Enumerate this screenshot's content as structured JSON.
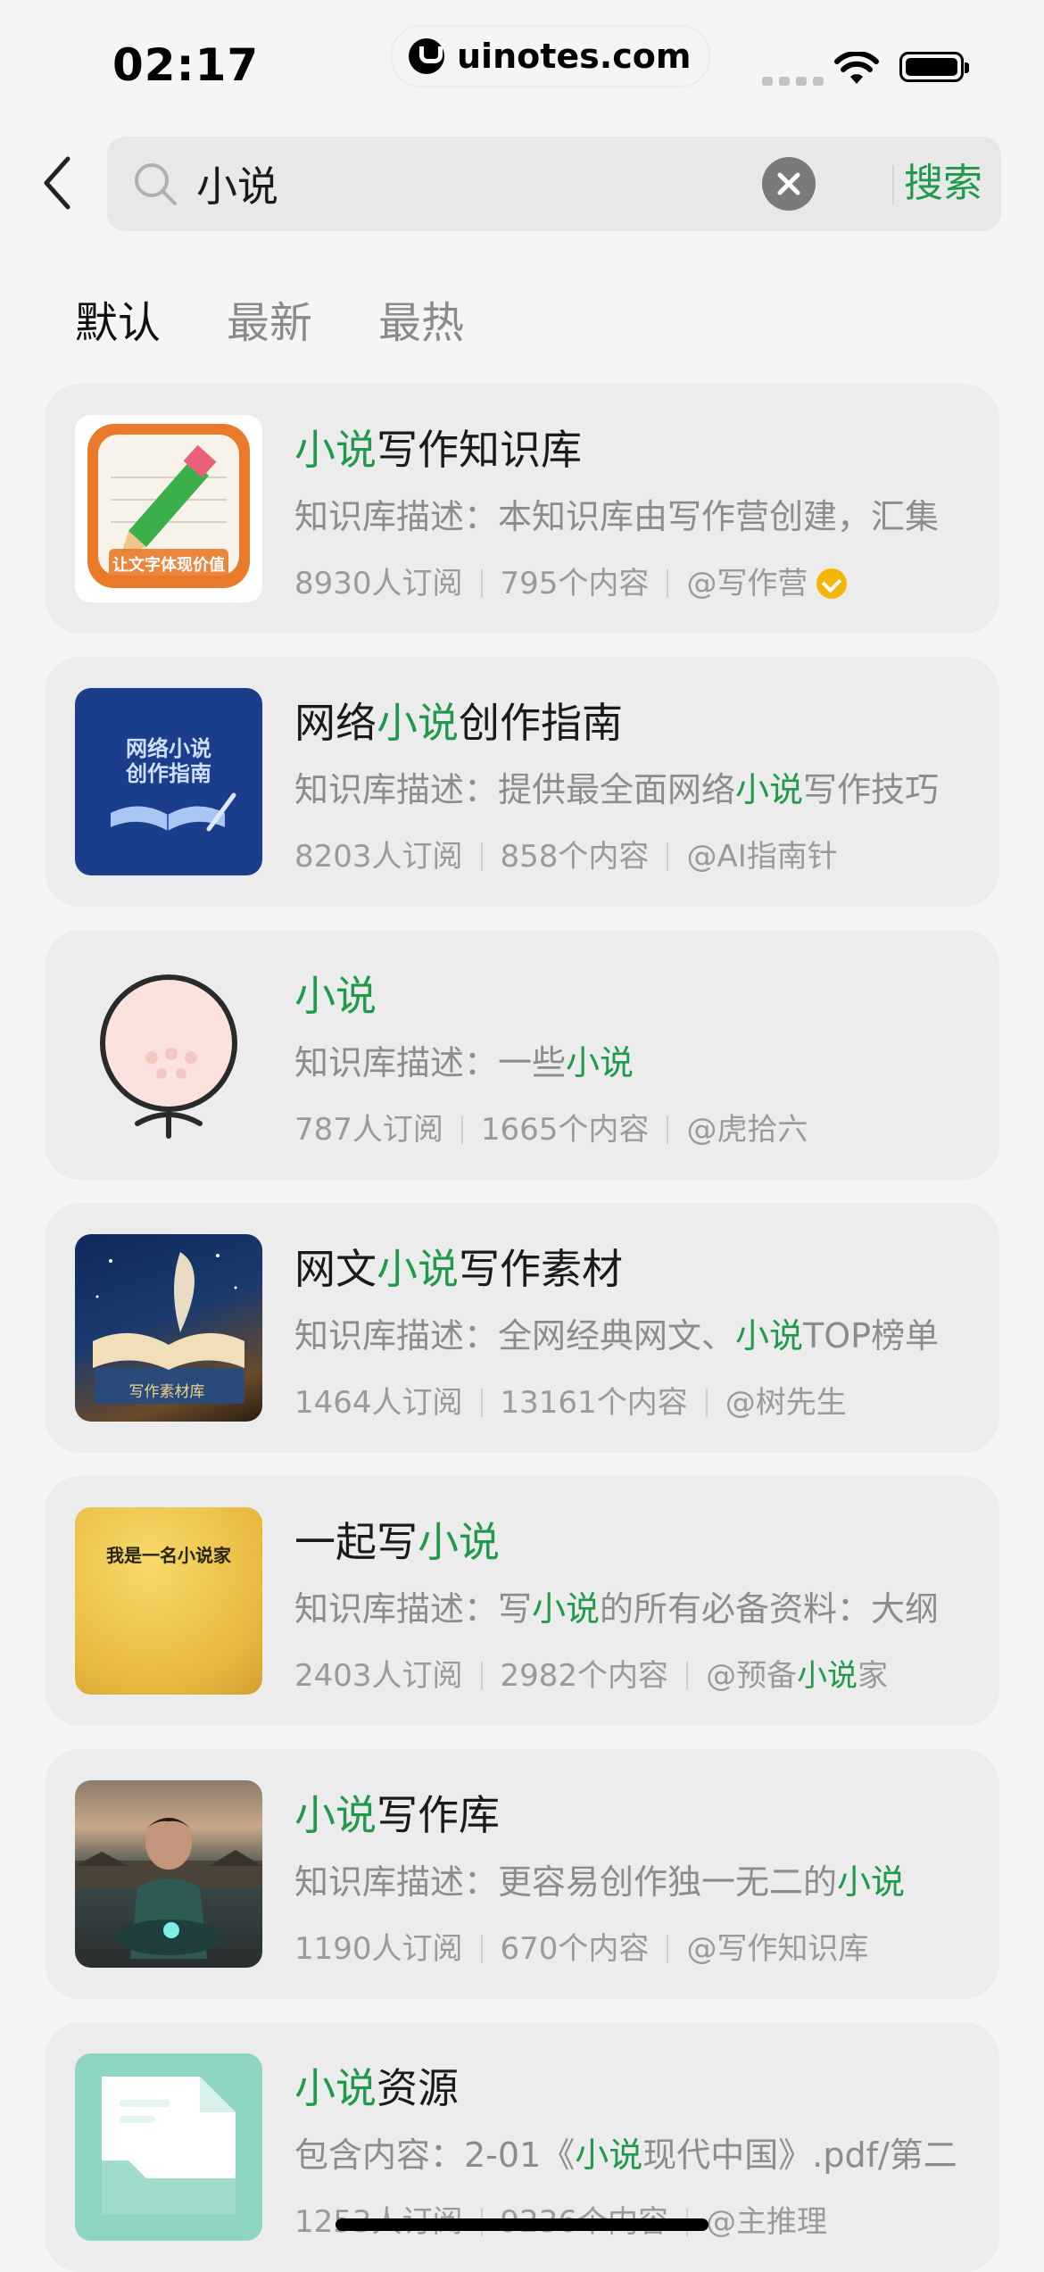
{
  "status": {
    "time": "02:17",
    "watermark": "uinotes.com"
  },
  "search": {
    "query": "小说",
    "placeholder": "小说",
    "submit_label": "搜索"
  },
  "tabs": [
    {
      "label": "默认"
    },
    {
      "label": "最新"
    },
    {
      "label": "最热"
    }
  ],
  "results": [
    {
      "title": [
        {
          "t": "小说",
          "hl": true
        },
        {
          "t": "写作知识库",
          "hl": false
        }
      ],
      "desc": [
        {
          "t": "知识库描述：本知识库由写作营创建，汇集",
          "hl": false
        }
      ],
      "subscribers": "8930人订阅",
      "contents": "795个内容",
      "author": "@写作营",
      "verified": true,
      "thumb_text": "让文字体现价值"
    },
    {
      "title": [
        {
          "t": "网络",
          "hl": false
        },
        {
          "t": "小说",
          "hl": true
        },
        {
          "t": "创作指南",
          "hl": false
        }
      ],
      "desc": [
        {
          "t": "知识库描述：提供最全面网络",
          "hl": false
        },
        {
          "t": "小说",
          "hl": true
        },
        {
          "t": "写作技巧",
          "hl": false
        }
      ],
      "subscribers": "8203人订阅",
      "contents": "858个内容",
      "author": "@AI指南针",
      "verified": false,
      "thumb_text": "网络小说创作指南"
    },
    {
      "title": [
        {
          "t": "小说",
          "hl": true
        }
      ],
      "desc": [
        {
          "t": "知识库描述：一些",
          "hl": false
        },
        {
          "t": "小说",
          "hl": true
        }
      ],
      "subscribers": "787人订阅",
      "contents": "1665个内容",
      "author": "@虎拾六",
      "verified": false,
      "thumb_text": ""
    },
    {
      "title": [
        {
          "t": "网文",
          "hl": false
        },
        {
          "t": "小说",
          "hl": true
        },
        {
          "t": "写作素材",
          "hl": false
        }
      ],
      "desc": [
        {
          "t": "知识库描述：全网经典网文、",
          "hl": false
        },
        {
          "t": "小说",
          "hl": true
        },
        {
          "t": "TOP榜单",
          "hl": false
        }
      ],
      "subscribers": "1464人订阅",
      "contents": "13161个内容",
      "author": "@树先生",
      "verified": false,
      "thumb_text": "写作素材库"
    },
    {
      "title": [
        {
          "t": "一起写",
          "hl": false
        },
        {
          "t": "小说",
          "hl": true
        }
      ],
      "desc": [
        {
          "t": "知识库描述：写",
          "hl": false
        },
        {
          "t": "小说",
          "hl": true
        },
        {
          "t": "的所有必备资料：大纲",
          "hl": false
        }
      ],
      "subscribers": "2403人订阅",
      "contents": "2982个内容",
      "author_parts": [
        {
          "t": "@预备",
          "hl": false
        },
        {
          "t": "小说",
          "hl": true
        },
        {
          "t": "家",
          "hl": false
        }
      ],
      "verified": false,
      "thumb_text": "我是一名小说家"
    },
    {
      "title": [
        {
          "t": "小说",
          "hl": true
        },
        {
          "t": "写作库",
          "hl": false
        }
      ],
      "desc": [
        {
          "t": "知识库描述：更容易创作独一无二的",
          "hl": false
        },
        {
          "t": "小说",
          "hl": true
        }
      ],
      "subscribers": "1190人订阅",
      "contents": "670个内容",
      "author": "@写作知识库",
      "verified": false,
      "thumb_text": ""
    },
    {
      "title": [
        {
          "t": "小说",
          "hl": true
        },
        {
          "t": "资源",
          "hl": false
        }
      ],
      "desc": [
        {
          "t": "包含内容：2-01《",
          "hl": false
        },
        {
          "t": "小说",
          "hl": true
        },
        {
          "t": "现代中国》.pdf/第二",
          "hl": false
        }
      ],
      "subscribers": "1253人订阅",
      "contents": "9236个内容",
      "author": "@主推理",
      "verified": false,
      "thumb_text": ""
    }
  ],
  "colors": {
    "accent": "#1f9a4a",
    "background": "#f5f5f5",
    "card": "#ececec"
  }
}
